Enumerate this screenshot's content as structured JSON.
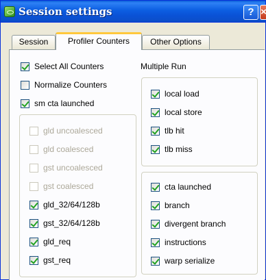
{
  "window": {
    "title": "Session settings",
    "help_label": "?",
    "close_label": "×"
  },
  "tabs": [
    {
      "label": "Session"
    },
    {
      "label": "Profiler Counters"
    },
    {
      "label": "Other Options"
    }
  ],
  "left": {
    "top_options": [
      {
        "label": "Select All Counters",
        "checked": true
      },
      {
        "label": "Normalize Counters",
        "checked": false
      },
      {
        "label": "sm cta launched",
        "checked": true
      }
    ],
    "group_items": [
      {
        "label": "gld uncoalesced",
        "checked": false,
        "enabled": false
      },
      {
        "label": "gld coalesced",
        "checked": false,
        "enabled": false
      },
      {
        "label": "gst uncoalesced",
        "checked": false,
        "enabled": false
      },
      {
        "label": "gst coalesced",
        "checked": false,
        "enabled": false
      },
      {
        "label": "gld_32/64/128b",
        "checked": true,
        "enabled": true
      },
      {
        "label": "gst_32/64/128b",
        "checked": true,
        "enabled": true
      },
      {
        "label": "gld_req",
        "checked": true,
        "enabled": true
      },
      {
        "label": "gst_req",
        "checked": true,
        "enabled": true
      }
    ]
  },
  "right": {
    "heading": "Multiple Run",
    "group1": [
      {
        "label": "local load",
        "checked": true
      },
      {
        "label": "local store",
        "checked": true
      },
      {
        "label": "tlb hit",
        "checked": true
      },
      {
        "label": "tlb miss",
        "checked": true
      }
    ],
    "group2": [
      {
        "label": "cta launched",
        "checked": true
      },
      {
        "label": "branch",
        "checked": true
      },
      {
        "label": "divergent branch",
        "checked": true
      },
      {
        "label": "instructions",
        "checked": true
      },
      {
        "label": "warp serialize",
        "checked": true
      }
    ]
  }
}
